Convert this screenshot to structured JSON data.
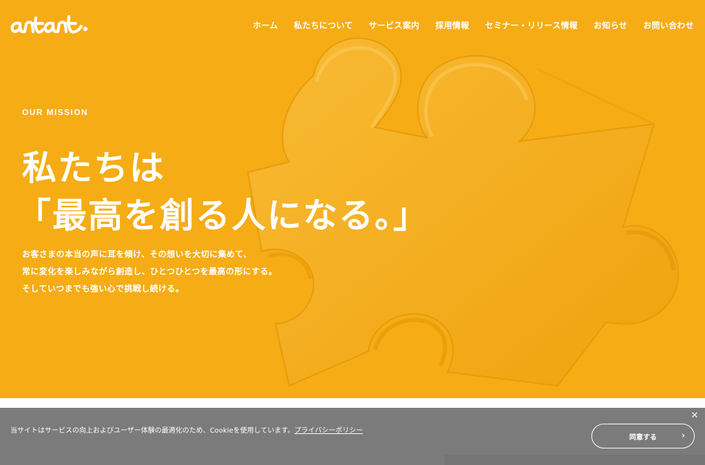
{
  "header": {
    "logo_text": "antant."
  },
  "nav": {
    "items": [
      {
        "label": "ホーム"
      },
      {
        "label": "私たちについて"
      },
      {
        "label": "サービス案内"
      },
      {
        "label": "採用情報"
      },
      {
        "label": "セミナー・リリース情報"
      },
      {
        "label": "お知らせ"
      },
      {
        "label": "お問い合わせ"
      }
    ]
  },
  "hero": {
    "eyebrow": "OUR MISSION",
    "headline_line1": "私たちは",
    "headline_line2": "「最高を創る人になる。」",
    "body_line1": "お客さまの本当の声に耳を傾け、その想いを大切に集めて、",
    "body_line2": "常に変化を楽しみながら創造し、ひとつひとつを最高の形にする。",
    "body_line3": "そしていつまでも強い心で挑戦し続ける。",
    "background_color": "#f6ac14",
    "background_image": "puzzle-piece-illustration"
  },
  "cookie_banner": {
    "message": "当サイトはサービスの向上およびユーザー体験の最適化のため、Cookieを使用しています。",
    "policy_link": "プライバシーポリシー",
    "agree_button": "同意する",
    "close_icon": "close-icon",
    "chevron_icon": "chevron-right-icon"
  }
}
